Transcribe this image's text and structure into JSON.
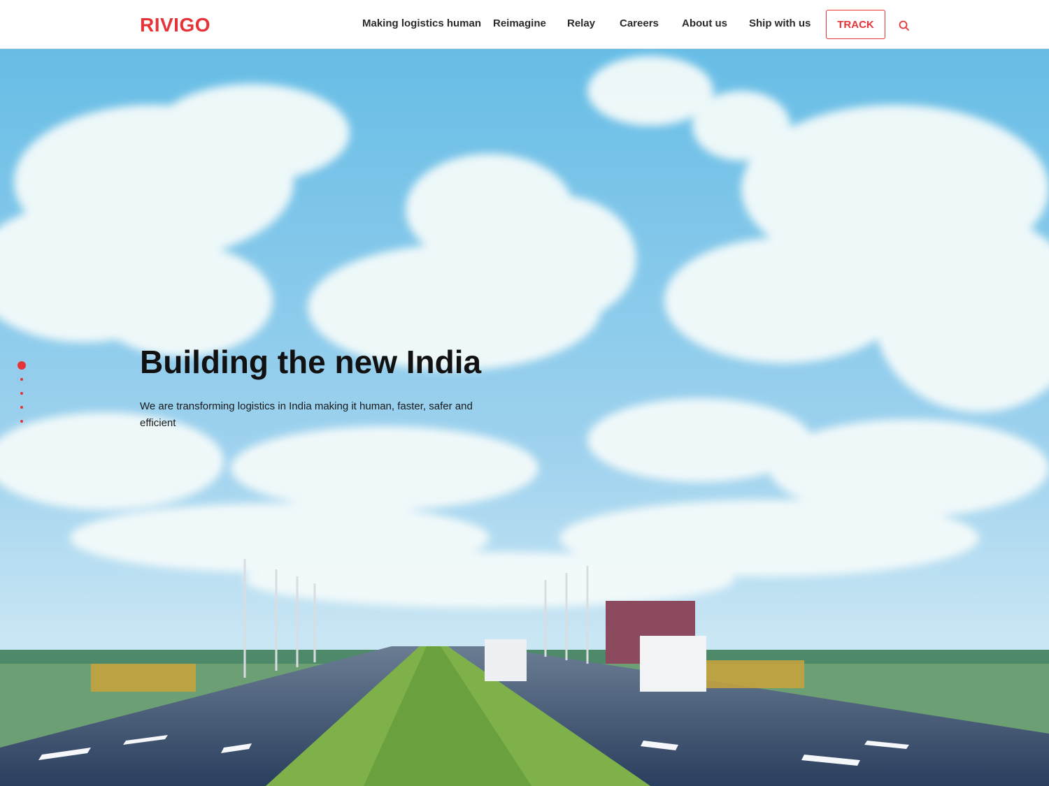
{
  "brand": {
    "logo_text": "RIVIGO",
    "accent_color": "#e63338"
  },
  "nav": {
    "items": [
      {
        "label": "Making logistics human"
      },
      {
        "label": "Reimagine"
      },
      {
        "label": "Relay"
      },
      {
        "label": "Careers"
      },
      {
        "label": "About us"
      },
      {
        "label": "Ship with us"
      }
    ],
    "track_label": "TRACK",
    "search_icon": "search-icon"
  },
  "hero": {
    "title": "Building the new India",
    "subtitle": "We are transforming logistics in India making it human, faster, safer and efficient",
    "slide_count": 5,
    "active_slide": 1
  }
}
